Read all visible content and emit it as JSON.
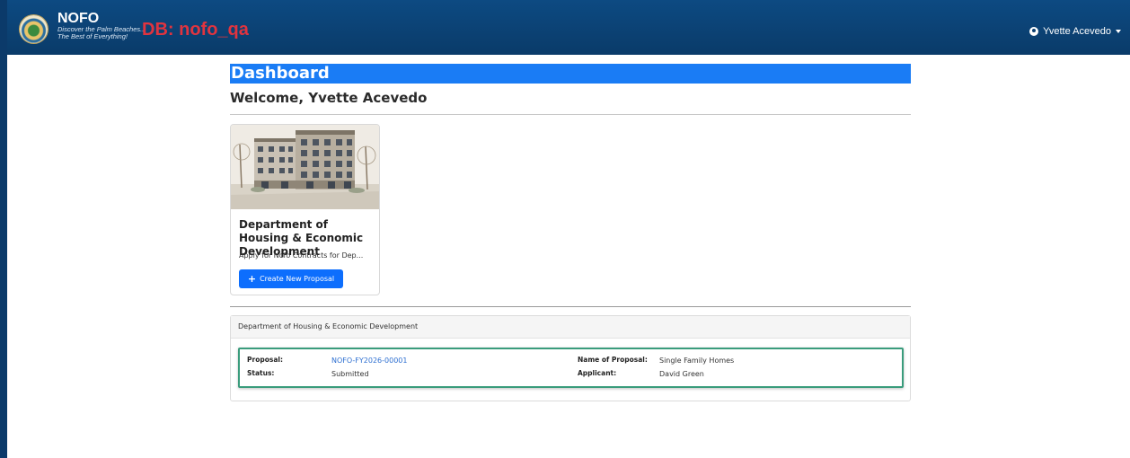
{
  "navbar": {
    "brand_name": "NOFO",
    "brand_tagline_1": "Discover the Palm Beaches...",
    "brand_tagline_2": "The Best of Everything!",
    "db_label": "DB: nofo_qa",
    "user_name": "Yvette Acevedo"
  },
  "dashboard": {
    "title": "Dashboard",
    "welcome": "Welcome, Yvette Acevedo"
  },
  "card": {
    "title": "Department of Housing & Economic Development",
    "description": "Apply for Nofo Contracts for Dep...",
    "button_label": "Create New Proposal"
  },
  "panel": {
    "header": "Department of Housing & Economic Development",
    "proposal_label": "Proposal:",
    "proposal_value": "NOFO-FY2026-00001",
    "status_label": "Status:",
    "status_value": "Submitted",
    "name_label": "Name of Proposal:",
    "name_value": "Single Family Homes",
    "applicant_label": "Applicant:",
    "applicant_value": "David Green"
  }
}
